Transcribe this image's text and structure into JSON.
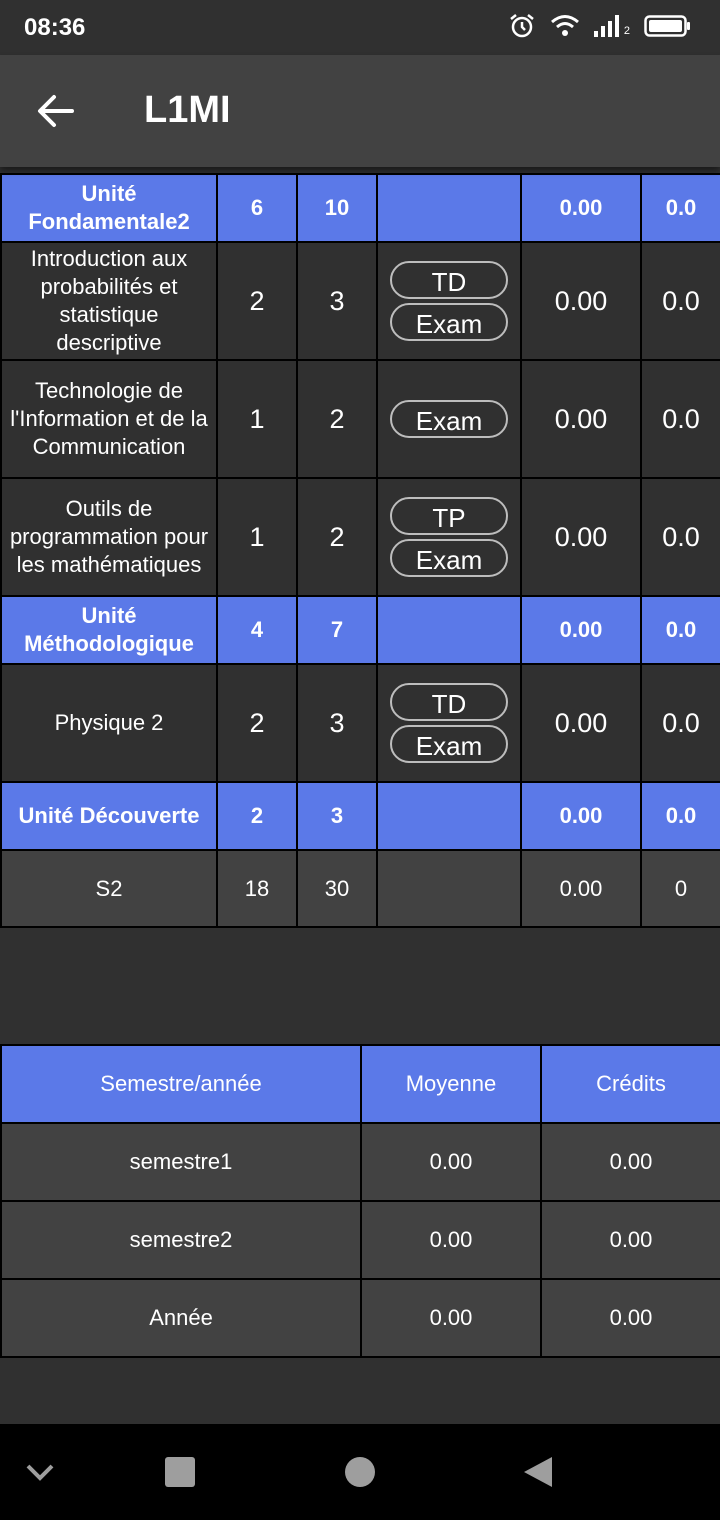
{
  "status_bar": {
    "time": "08:36",
    "signal_sub": "2"
  },
  "app_bar": {
    "title": "L1MI"
  },
  "grades": {
    "rows": [
      {
        "type": "unit",
        "name": "Unité Fondamentale2",
        "coef": "6",
        "credits": "10",
        "avg": "0.00",
        "earned": "0.0"
      },
      {
        "type": "subject",
        "name": "Introduction aux probabilités et statistique descriptive",
        "coef": "2",
        "credits": "3",
        "buttons": [
          "TD",
          "Exam"
        ],
        "avg": "0.00",
        "earned": "0.0"
      },
      {
        "type": "subject",
        "name": "Technologie de l'Information et de la Communication",
        "coef": "1",
        "credits": "2",
        "buttons": [
          "Exam"
        ],
        "avg": "0.00",
        "earned": "0.0"
      },
      {
        "type": "subject",
        "name": "Outils de programmation pour les mathématiques",
        "coef": "1",
        "credits": "2",
        "buttons": [
          "TP",
          "Exam"
        ],
        "avg": "0.00",
        "earned": "0.0"
      },
      {
        "type": "unit",
        "name": "Unité Méthodologique",
        "coef": "4",
        "credits": "7",
        "avg": "0.00",
        "earned": "0.0"
      },
      {
        "type": "subject",
        "name": "Physique 2",
        "coef": "2",
        "credits": "3",
        "buttons": [
          "TD",
          "Exam"
        ],
        "avg": "0.00",
        "earned": "0.0"
      },
      {
        "type": "unit",
        "name": "Unité Découverte",
        "coef": "2",
        "credits": "3",
        "avg": "0.00",
        "earned": "0.0"
      },
      {
        "type": "total",
        "name": "S2",
        "coef": "18",
        "credits": "30",
        "avg": "0.00",
        "earned": "0"
      }
    ]
  },
  "summary": {
    "headers": [
      "Semestre/année",
      "Moyenne",
      "Crédits"
    ],
    "rows": [
      {
        "label": "semestre1",
        "avg": "0.00",
        "credits": "0.00"
      },
      {
        "label": "semestre2",
        "avg": "0.00",
        "credits": "0.00"
      },
      {
        "label": "Année",
        "avg": "0.00",
        "credits": "0.00"
      }
    ]
  },
  "colors": {
    "accent": "#5b79e8",
    "background": "#303030",
    "surface": "#424242"
  }
}
